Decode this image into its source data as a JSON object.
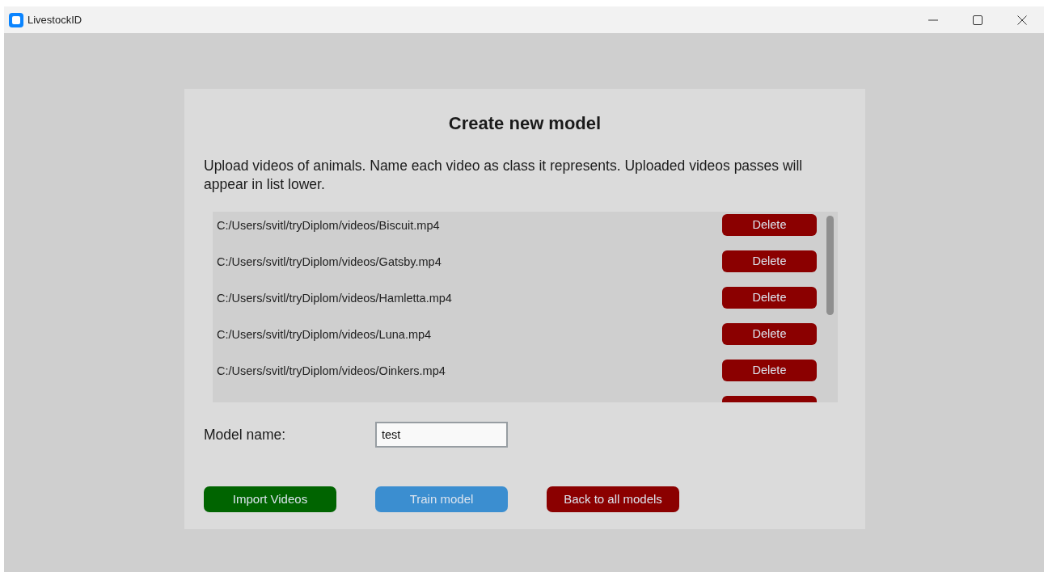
{
  "window": {
    "title": "LivestockID"
  },
  "heading": "Create new model",
  "instructions": "Upload videos of animals. Name each video as class it represents. Uploaded videos passes will appear in list lower.",
  "videos": [
    {
      "kind": "full",
      "path": "C:/Users/svitl/tryDiplom/videos/Biscuit.mp4",
      "button": "Delete"
    },
    {
      "kind": "full",
      "path": "C:/Users/svitl/tryDiplom/videos/Gatsby.mp4",
      "button": "Delete"
    },
    {
      "kind": "full",
      "path": "C:/Users/svitl/tryDiplom/videos/Hamletta.mp4",
      "button": "Delete"
    },
    {
      "kind": "full",
      "path": "C:/Users/svitl/tryDiplom/videos/Luna.mp4",
      "button": "Delete"
    },
    {
      "kind": "full",
      "path": "C:/Users/svitl/tryDiplom/videos/Oinkers.mp4",
      "button": "Delete"
    },
    {
      "kind": "partial"
    }
  ],
  "model_name": {
    "label": "Model name:",
    "value": "test"
  },
  "buttons": [
    {
      "label": "Import Videos",
      "color": "#006400"
    },
    {
      "label": "Train model",
      "color": "#3b8ed0"
    },
    {
      "label": "Back to all models",
      "color": "#8b0000"
    }
  ]
}
